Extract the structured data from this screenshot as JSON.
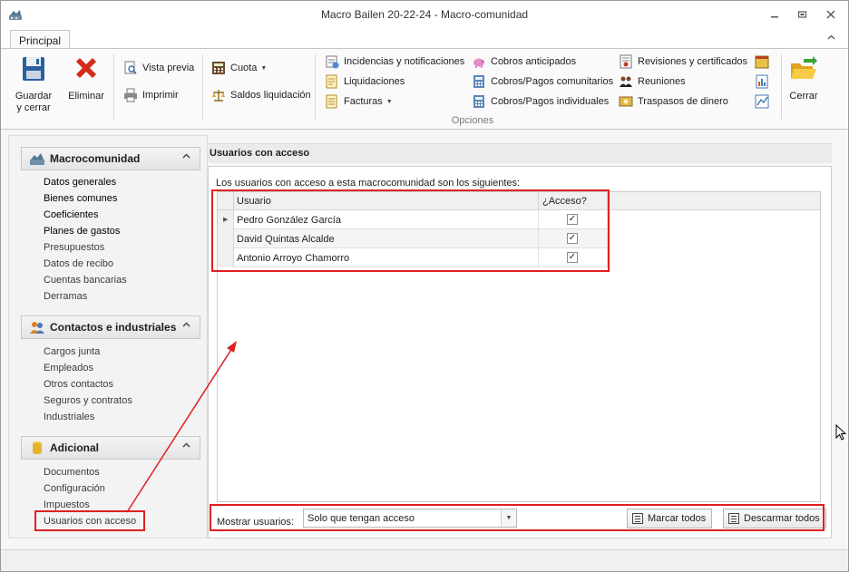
{
  "window": {
    "title": "Macro Bailen 20-22-24 - Macro-comunidad"
  },
  "ribbon": {
    "tab_label": "Principal",
    "save_label_line1": "Guardar",
    "save_label_line2": "y cerrar",
    "delete_label": "Eliminar",
    "preview_label": "Vista previa",
    "print_label": "Imprimir",
    "cuota_label": "Cuota",
    "saldos_label": "Saldos liquidación",
    "incidencias_label": "Incidencias y notificaciones",
    "liquidaciones_label": "Liquidaciones",
    "facturas_label": "Facturas",
    "cobros_anticipados_label": "Cobros anticipados",
    "cobros_comunitarios_label": "Cobros/Pagos comunitarios",
    "cobros_individuales_label": "Cobros/Pagos individuales",
    "revisiones_label": "Revisiones y certificados",
    "reuniones_label": "Reuniones",
    "traspasos_label": "Traspasos de dinero",
    "close_label": "Cerrar",
    "group_label": "Opciones"
  },
  "nav": {
    "macro": {
      "title": "Macrocomunidad",
      "items": [
        "Datos generales",
        "Bienes comunes",
        "Coeficientes",
        "Planes de gastos",
        "Presupuestos",
        "Datos de recibo",
        "Cuentas bancarias",
        "Derramas"
      ]
    },
    "contactos": {
      "title": "Contactos e industriales",
      "items": [
        "Cargos junta",
        "Empleados",
        "Otros contactos",
        "Seguros y contratos",
        "Industriales"
      ]
    },
    "adicional": {
      "title": "Adicional",
      "items": [
        "Documentos",
        "Configuración",
        "Impuestos",
        "Usuarios con acceso"
      ]
    }
  },
  "main": {
    "title": "Usuarios con acceso",
    "intro": "Los usuarios con acceso a esta macrocomunidad son los siguientes:",
    "columns": {
      "user": "Usuario",
      "access": "¿Acceso?"
    },
    "rows": [
      {
        "name": "Pedro González García",
        "access": true
      },
      {
        "name": "David Quintas Alcalde",
        "access": true
      },
      {
        "name": "Antonio Arroyo Chamorro",
        "access": true
      }
    ],
    "show_label": "Mostrar usuarios:",
    "show_value": "Solo que tengan acceso",
    "mark_all": "Marcar todos",
    "unmark_all": "Descarmar todos"
  },
  "colors": {
    "annotation_red": "#e02020"
  }
}
